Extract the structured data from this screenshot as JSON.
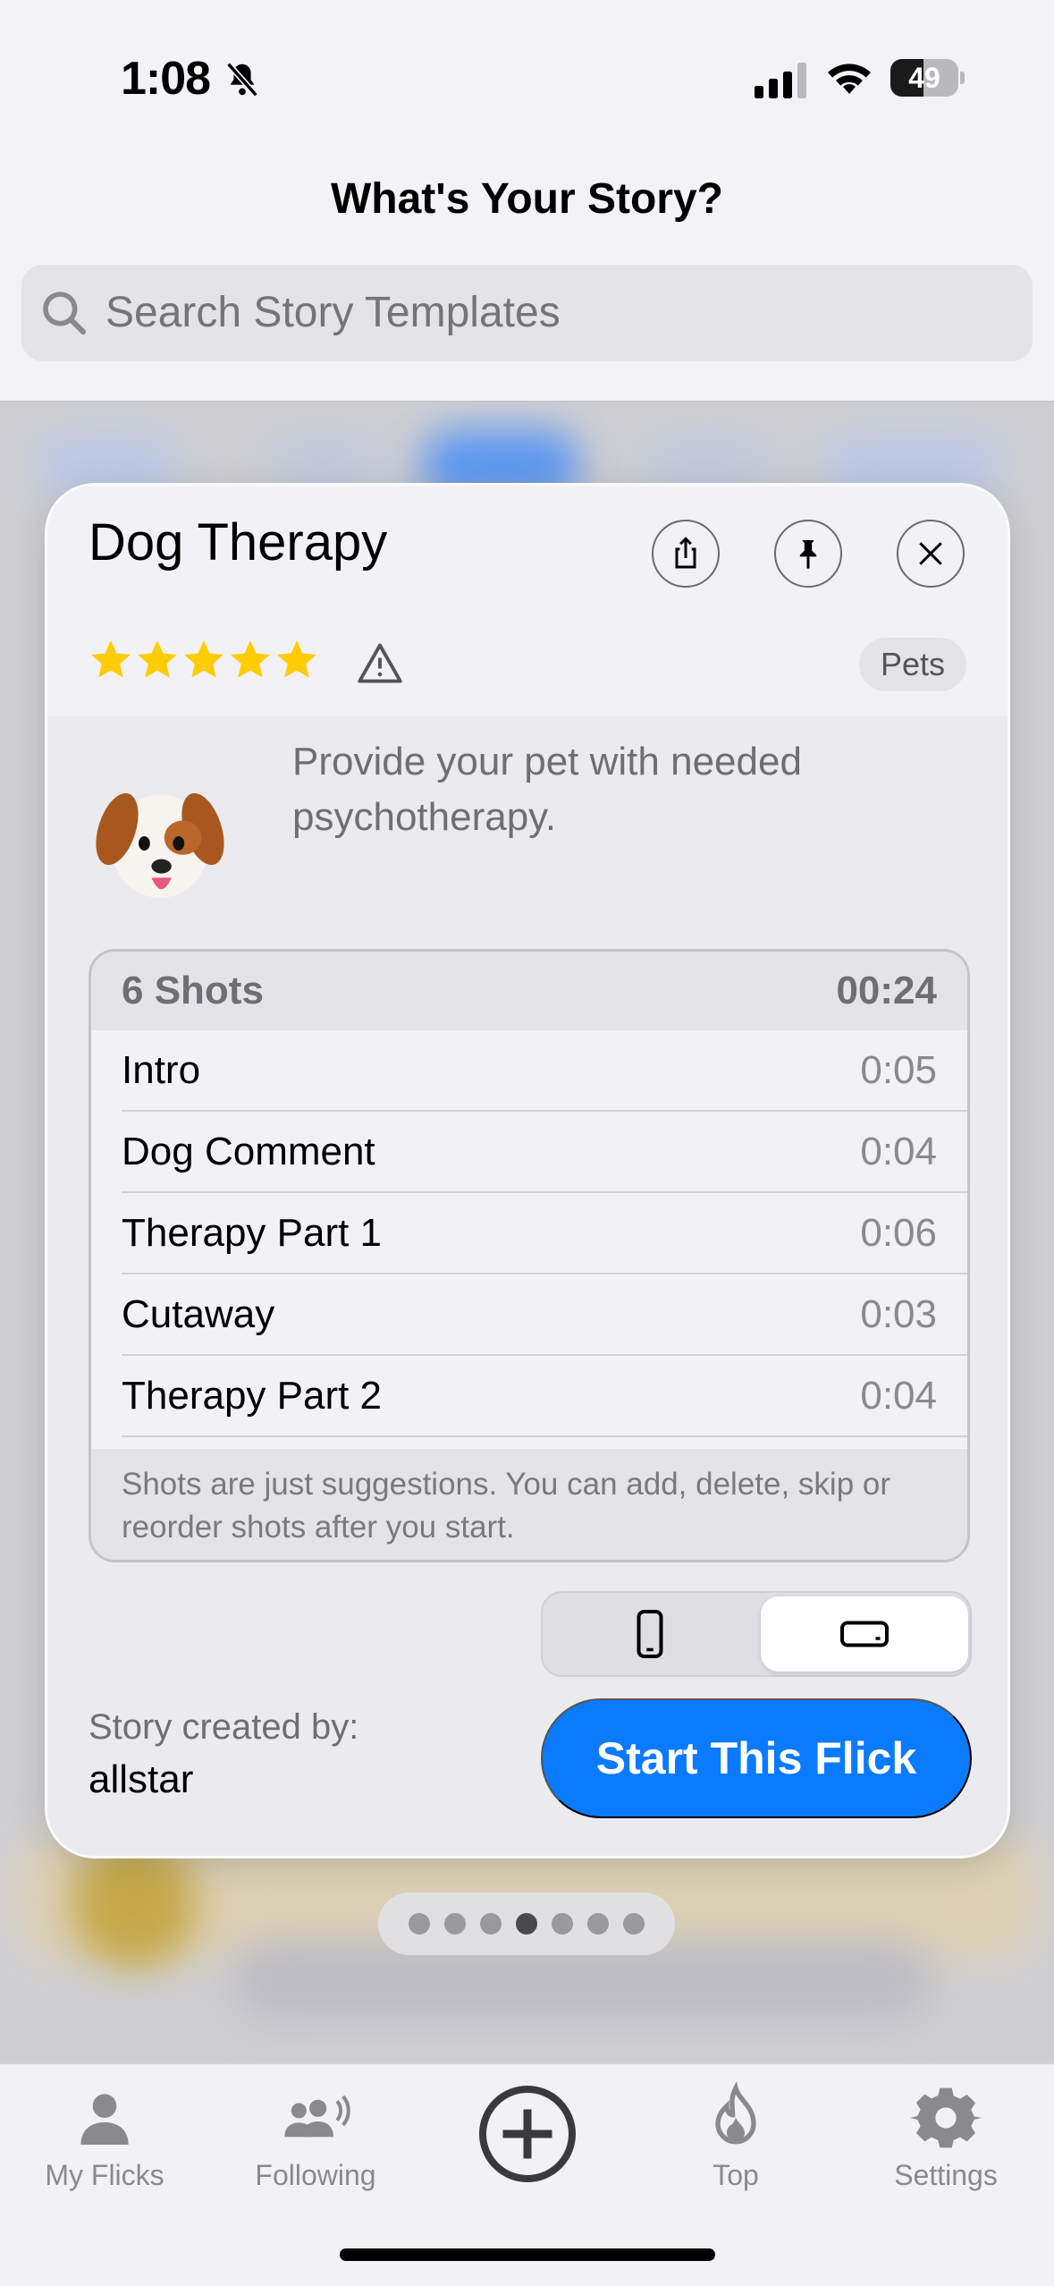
{
  "status_bar": {
    "time": "1:08",
    "battery_level": "49",
    "battery_fraction": 0.49,
    "icons": [
      "bell-slash-icon",
      "cellular-signal-icon",
      "wifi-icon",
      "battery-icon"
    ]
  },
  "header": {
    "title": "What's Your Story?",
    "search_placeholder": "Search Story Templates"
  },
  "card": {
    "title": "Dog Therapy",
    "actions": [
      "share-icon",
      "pin-icon",
      "close-icon"
    ],
    "rating_stars": 5,
    "category": "Pets",
    "emoji": "dog-face-emoji",
    "description": "Provide your pet with needed psychotherapy.",
    "shots": {
      "count_label": "6 Shots",
      "total_duration": "00:24",
      "rows": [
        {
          "name": "Intro",
          "duration": "0:05"
        },
        {
          "name": "Dog Comment",
          "duration": "0:04"
        },
        {
          "name": "Therapy Part 1",
          "duration": "0:06"
        },
        {
          "name": "Cutaway",
          "duration": "0:03"
        },
        {
          "name": "Therapy Part 2",
          "duration": "0:04"
        }
      ],
      "note": "Shots are just suggestions. You can add, delete, skip or reorder shots after you start."
    },
    "orientation": {
      "options": [
        "portrait-phone-icon",
        "landscape-phone-icon"
      ],
      "selected": "landscape"
    },
    "creator_label": "Story created by:",
    "creator_name": "allstar",
    "start_button": "Start This Flick"
  },
  "pager": {
    "total": 7,
    "active_index": 3
  },
  "tab_bar": {
    "items": [
      {
        "label": "My Flicks",
        "icon": "person-icon"
      },
      {
        "label": "Following",
        "icon": "people-icon"
      },
      {
        "label": "",
        "icon": "plus-circle-icon"
      },
      {
        "label": "Top",
        "icon": "flame-icon"
      },
      {
        "label": "Settings",
        "icon": "gear-icon"
      }
    ]
  },
  "colors": {
    "accent": "#0a7aff",
    "star": "#ffcc00",
    "background": "#f2f2f7"
  }
}
